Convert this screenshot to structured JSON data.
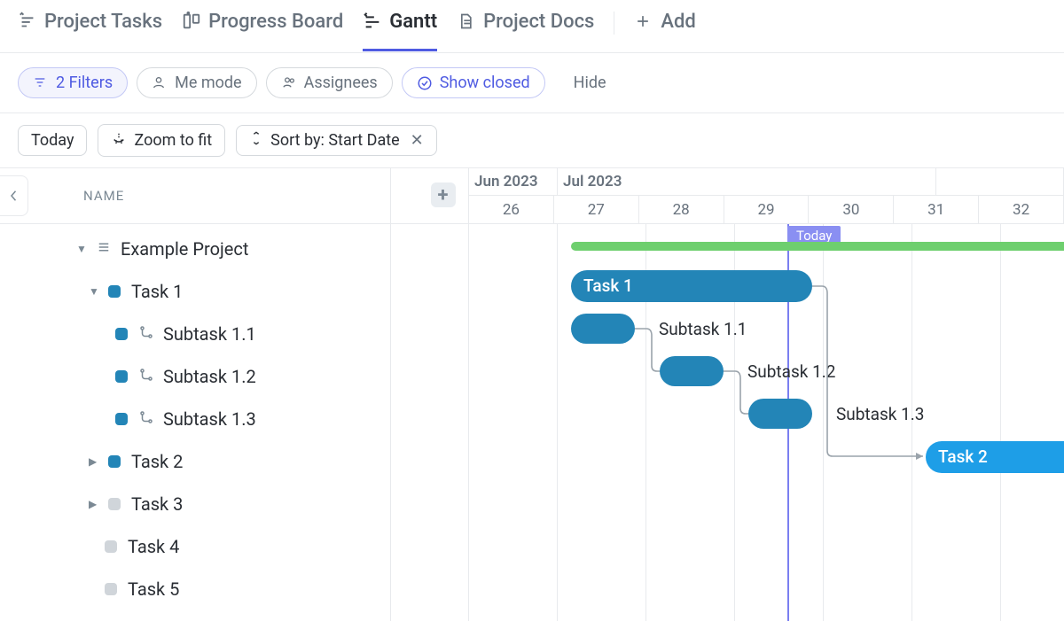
{
  "tabs": {
    "projectTasks": "Project Tasks",
    "progressBoard": "Progress Board",
    "gantt": "Gantt",
    "projectDocs": "Project Docs",
    "add": "Add"
  },
  "pills": {
    "filters": "2 Filters",
    "meMode": "Me mode",
    "assignees": "Assignees",
    "showClosed": "Show closed",
    "hide": "Hide"
  },
  "toolbar": {
    "today": "Today",
    "zoom": "Zoom to fit",
    "sort": "Sort by: Start Date"
  },
  "columns": {
    "name": "NAME"
  },
  "timeline": {
    "months": {
      "m1": "Jun 2023",
      "m2": "Jul 2023",
      "m3": ""
    },
    "weeks": [
      "26",
      "27",
      "28",
      "29",
      "30",
      "31",
      "32"
    ],
    "todayLabel": "Today"
  },
  "tasks": {
    "project": "Example Project",
    "task1": {
      "label": "Task 1"
    },
    "sub11": {
      "label": "Subtask 1.1"
    },
    "sub12": {
      "label": "Subtask 1.2"
    },
    "sub13": {
      "label": "Subtask 1.3"
    },
    "task2": {
      "label": "Task 2"
    },
    "task3": {
      "label": "Task 3"
    },
    "task4": {
      "label": "Task 4"
    },
    "task5": {
      "label": "Task 5"
    }
  },
  "chart_data": {
    "type": "gantt",
    "x_unit": "iso_week",
    "weeks_shown": [
      26,
      27,
      28,
      29,
      30,
      31,
      32
    ],
    "months": [
      {
        "label": "Jun 2023",
        "week_span": [
          26,
          26
        ]
      },
      {
        "label": "Jul 2023",
        "week_span": [
          27,
          30
        ]
      }
    ],
    "today_week": 29.5,
    "bars": [
      {
        "id": "project",
        "name": "Example Project",
        "start_week": 27.1,
        "end_week": 33.0,
        "color": "#6ecf6e",
        "type": "summary"
      },
      {
        "id": "task1",
        "name": "Task 1",
        "start_week": 27.1,
        "end_week": 29.8,
        "color": "#2385b7",
        "parent": "project"
      },
      {
        "id": "sub11",
        "name": "Subtask 1.1",
        "start_week": 27.1,
        "end_week": 27.8,
        "color": "#2385b7",
        "parent": "task1"
      },
      {
        "id": "sub12",
        "name": "Subtask 1.2",
        "start_week": 28.1,
        "end_week": 28.8,
        "color": "#2385b7",
        "parent": "task1"
      },
      {
        "id": "sub13",
        "name": "Subtask 1.3",
        "start_week": 29.1,
        "end_week": 29.8,
        "color": "#2385b7",
        "parent": "task1"
      },
      {
        "id": "task2",
        "name": "Task 2",
        "start_week": 31.1,
        "end_week": 33.0,
        "color": "#1e9ee7",
        "parent": "project"
      },
      {
        "id": "task3",
        "name": "Task 3",
        "start_week": null,
        "end_week": null,
        "color": null,
        "parent": "project"
      },
      {
        "id": "task4",
        "name": "Task 4",
        "start_week": null,
        "end_week": null,
        "color": null,
        "parent": "project"
      },
      {
        "id": "task5",
        "name": "Task 5",
        "start_week": null,
        "end_week": null,
        "color": null,
        "parent": "project"
      }
    ],
    "dependencies": [
      {
        "from": "sub11",
        "to": "sub12"
      },
      {
        "from": "sub12",
        "to": "sub13"
      },
      {
        "from": "task1",
        "to": "task2"
      }
    ]
  }
}
